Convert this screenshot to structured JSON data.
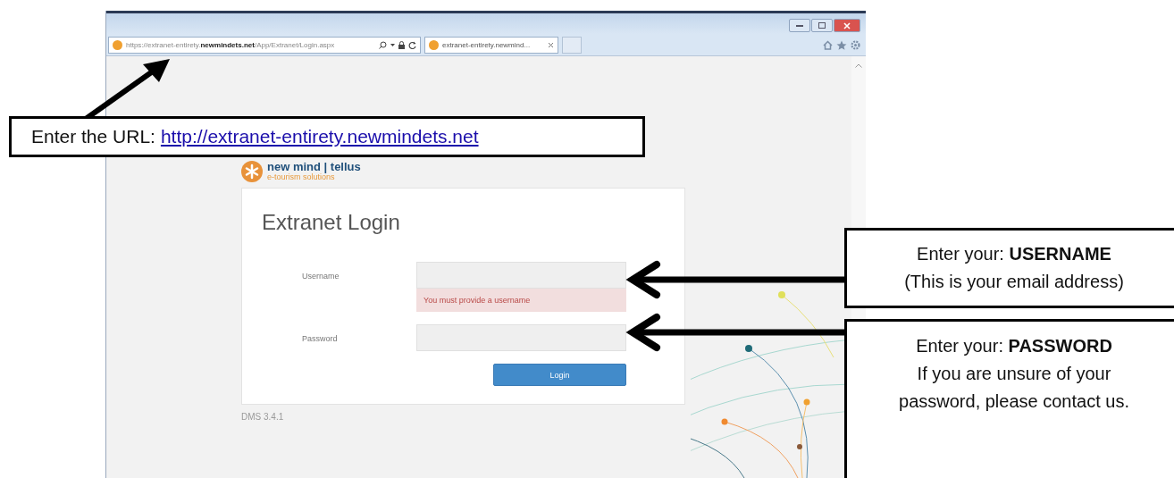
{
  "browser": {
    "address_bar": {
      "url": "https://extranet-entirety.**newmindets.net**/App/Extranet/Login.aspx"
    },
    "tabs": [
      {
        "label": "extranet-entirety.newmind...",
        "selected": true
      }
    ]
  },
  "page": {
    "logo": {
      "name": "new mind | tellus",
      "tagline": "e-tourism solutions"
    },
    "login": {
      "title": "Extranet Login",
      "fields": [
        {
          "label": "Username",
          "error": "You must provide a username"
        },
        {
          "label": "Password"
        }
      ],
      "button": "Login"
    },
    "version": "DMS 3.4.1"
  },
  "url_callout": {
    "text": "Enter the URL:",
    "link": "http://extranet-entirety.newmindets.net"
  },
  "callouts": [
    {
      "lines": [
        "Enter your: **USERNAME**",
        "(This is your email address)"
      ]
    },
    {
      "lines": [
        "Enter your: **PASSWORD**",
        "If you are unsure of your",
        "password, please contact us."
      ]
    }
  ]
}
